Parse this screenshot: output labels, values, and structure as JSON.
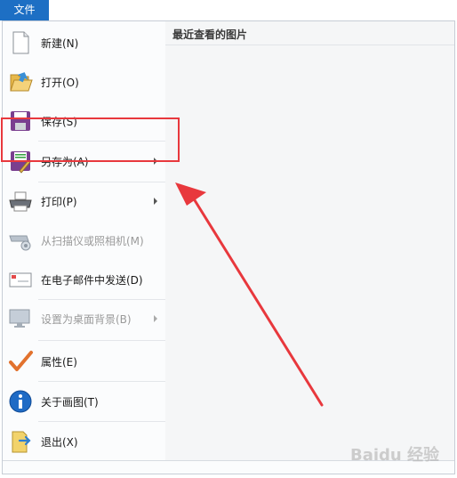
{
  "tab": {
    "label": "文件"
  },
  "menu": {
    "items": [
      {
        "label": "新建(N)",
        "icon": "new-file-icon",
        "enabled": true,
        "submenu": false
      },
      {
        "label": "打开(O)",
        "icon": "open-folder-icon",
        "enabled": true,
        "submenu": false
      },
      {
        "label": "保存(S)",
        "icon": "save-floppy-icon",
        "enabled": true,
        "submenu": false
      },
      {
        "label": "另存为(A)",
        "icon": "save-as-icon",
        "enabled": true,
        "submenu": true
      },
      {
        "label": "打印(P)",
        "icon": "printer-icon",
        "enabled": true,
        "submenu": true
      },
      {
        "label": "从扫描仪或照相机(M)",
        "icon": "scanner-camera-icon",
        "enabled": false,
        "submenu": false
      },
      {
        "label": "在电子邮件中发送(D)",
        "icon": "email-icon",
        "enabled": true,
        "submenu": false
      },
      {
        "label": "设置为桌面背景(B)",
        "icon": "desktop-background-icon",
        "enabled": false,
        "submenu": true
      },
      {
        "label": "属性(E)",
        "icon": "checkmark-icon",
        "enabled": true,
        "submenu": false
      },
      {
        "label": "关于画图(T)",
        "icon": "info-icon",
        "enabled": true,
        "submenu": false
      },
      {
        "label": "退出(X)",
        "icon": "exit-icon",
        "enabled": true,
        "submenu": false
      }
    ]
  },
  "recent": {
    "title": "最近查看的图片"
  },
  "watermark": "Baidu 经验",
  "colors": {
    "tab": "#1d6fc4",
    "highlight": "#e8383d"
  }
}
